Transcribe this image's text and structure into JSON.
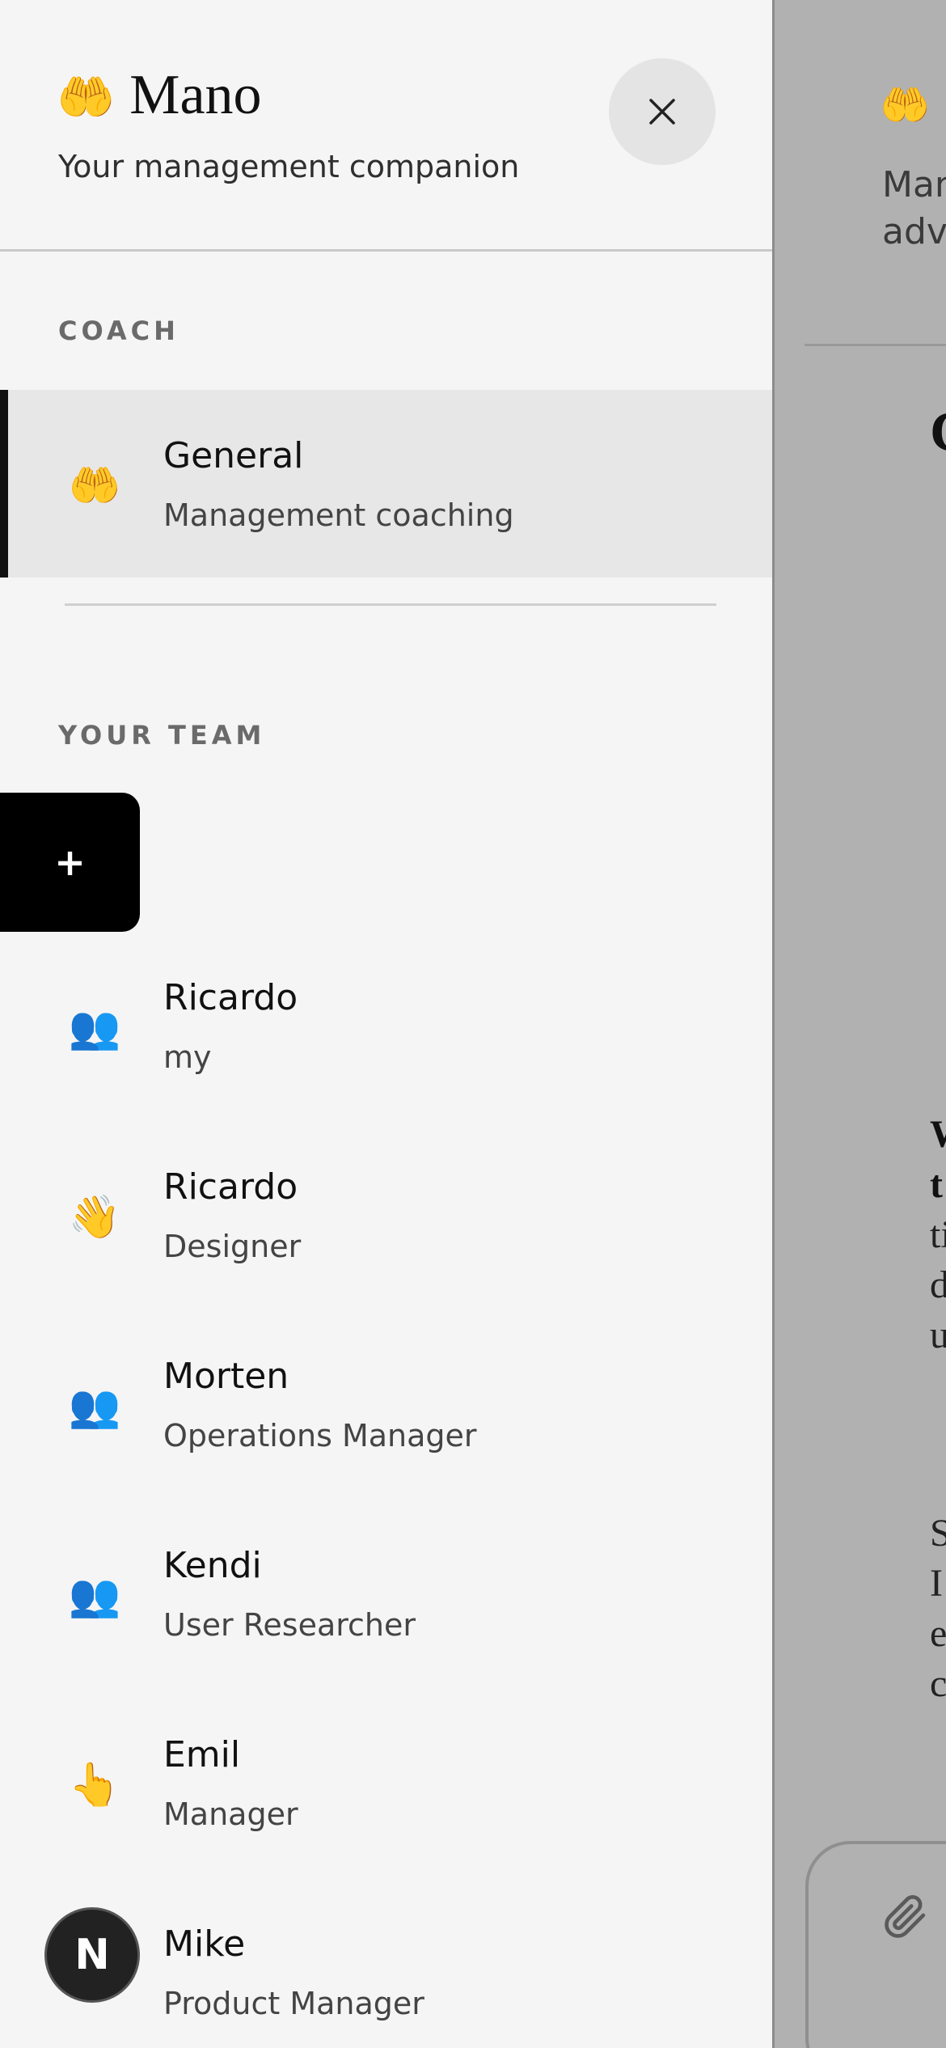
{
  "background": {
    "logo_emoji": "🤲",
    "subtitle_lines": [
      "Man",
      "advi"
    ],
    "heading_fragment": "C",
    "text_block_1": [
      "W",
      "t",
      "ti",
      "d",
      "u"
    ],
    "text_block_2": [
      "S",
      "I",
      "e",
      "c"
    ]
  },
  "drawer": {
    "app_emoji": "🤲",
    "app_name": "Mano",
    "tagline": "Your management companion",
    "coach_section_label": "COACH",
    "coach": {
      "icon": "🤲",
      "name": "General",
      "role": "Management coaching"
    },
    "team_section_label": "YOUR TEAM",
    "add_button_label": "+",
    "team": [
      {
        "icon": "👥",
        "name": "Ricardo",
        "role": "my"
      },
      {
        "icon": "👋",
        "name": "Ricardo",
        "role": "Designer"
      },
      {
        "icon": "👥",
        "name": "Morten",
        "role": "Operations Manager"
      },
      {
        "icon": "👥",
        "name": "Kendi",
        "role": "User Researcher"
      },
      {
        "icon": "👆",
        "name": "Emil",
        "role": "Manager"
      },
      {
        "icon": "",
        "name": "Mike",
        "role": "Product Manager"
      }
    ],
    "user_avatar_initial": "N"
  }
}
